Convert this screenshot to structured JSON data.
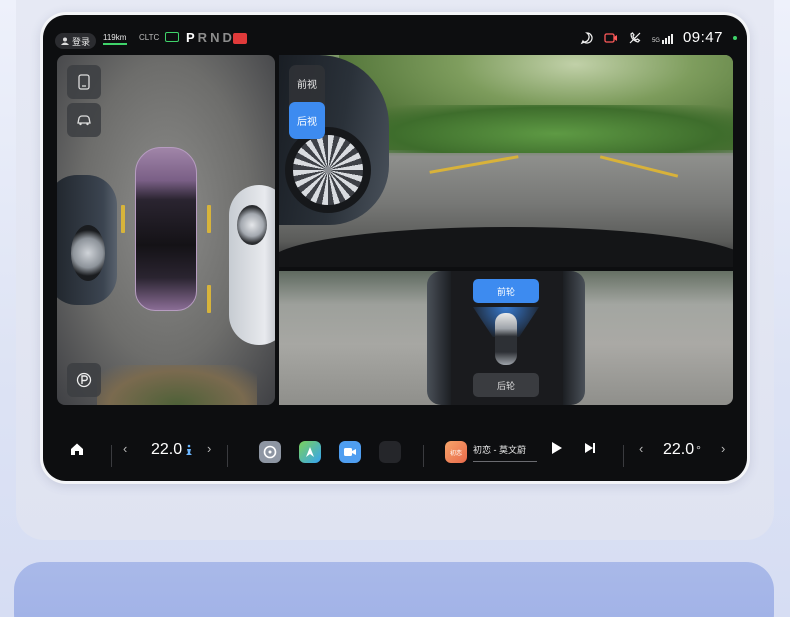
{
  "status": {
    "login_label": "登录",
    "range": "119km",
    "range_mode": "CLTC",
    "gears": [
      "P",
      "R",
      "N",
      "D"
    ],
    "active_gear": "P",
    "time": "09:47",
    "signal": "5G"
  },
  "views": {
    "front": "前视",
    "rear": "后视",
    "active": "后视"
  },
  "wheel_views": {
    "front": "前轮",
    "rear": "后轮",
    "active": "前轮"
  },
  "climate": {
    "left_temp": "22.0",
    "left_temp_icon": "seat-icon",
    "right_temp": "22.0",
    "right_unit": "°"
  },
  "media": {
    "song": "初恋 - 莫文蔚",
    "album_art_text": "初恋"
  },
  "dock_apps": [
    "steering-app-icon",
    "maps-app-icon",
    "video-call-app-icon",
    "app-grid-icon"
  ],
  "colors": {
    "accent_blue": "#3d8bf0",
    "status_green": "#3fd36a",
    "alert_red": "#e03a3a"
  }
}
